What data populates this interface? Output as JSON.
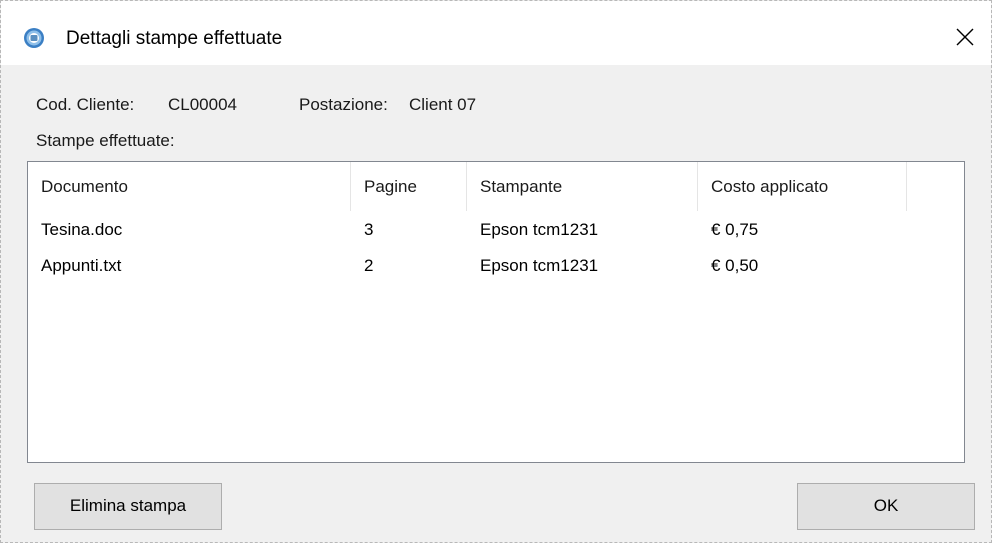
{
  "window": {
    "title": "Dettagli stampe effettuate",
    "app_icon": "printer-globe-icon",
    "close_icon": "close-icon"
  },
  "info": {
    "client_code_label": "Cod. Cliente:",
    "client_code_value": "CL00004",
    "station_label": "Postazione:",
    "station_value": "Client 07",
    "prints_label": "Stampe effettuate:"
  },
  "table": {
    "columns": [
      "Documento",
      "Pagine",
      "Stampante",
      "Costo applicato"
    ],
    "rows": [
      [
        "Tesina.doc",
        "3",
        "Epson tcm1231",
        "€ 0,75"
      ],
      [
        "Appunti.txt",
        "2",
        "Epson tcm1231",
        "€ 0,50"
      ]
    ]
  },
  "buttons": {
    "delete_label": "Elimina stampa",
    "ok_label": "OK"
  }
}
